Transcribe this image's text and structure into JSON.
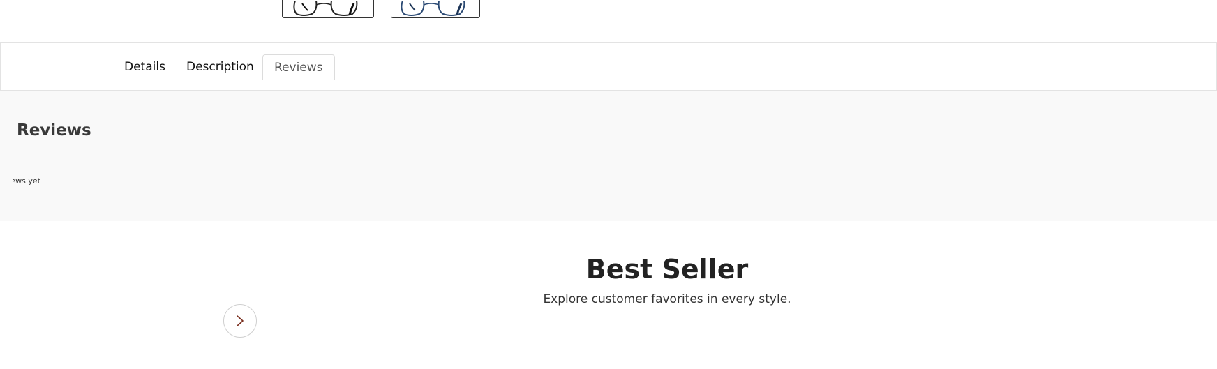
{
  "tabs": [
    {
      "label": "Details"
    },
    {
      "label": "Description"
    },
    {
      "label": "Reviews",
      "active": true
    }
  ],
  "reviews": {
    "title": "Reviews",
    "empty_text": "There are no reviews yet."
  },
  "best_seller": {
    "title": "Best Seller",
    "subtitle": "Explore customer favorites in every style.",
    "next_icon": "chevron-right-icon"
  },
  "thumbnails": [
    {
      "name": "black-frame-glasses",
      "color": "#222222"
    },
    {
      "name": "navy-frame-glasses",
      "color": "#2b4a74"
    }
  ],
  "colors": {
    "panel_bg": "#f9f9f9",
    "tab_active_border": "#dcdcdc",
    "arrow": "#7a2e1e"
  }
}
